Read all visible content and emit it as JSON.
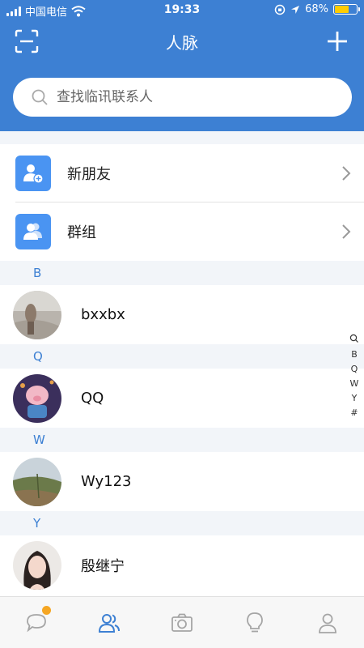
{
  "status": {
    "carrier": "中国电信",
    "time": "19:33",
    "battery": "68%",
    "battery_level": 0.68
  },
  "header": {
    "title": "人脉"
  },
  "search": {
    "placeholder": "查找临讯联系人"
  },
  "entries": [
    {
      "label": "新朋友",
      "icon": "add-user-icon"
    },
    {
      "label": "群组",
      "icon": "group-icon"
    }
  ],
  "sections": [
    {
      "letter": "B",
      "contacts": [
        {
          "name": "bxxbx"
        }
      ]
    },
    {
      "letter": "Q",
      "contacts": [
        {
          "name": "QQ"
        }
      ]
    },
    {
      "letter": "W",
      "contacts": [
        {
          "name": "Wy123"
        }
      ]
    },
    {
      "letter": "Y",
      "contacts": [
        {
          "name": "殷继宁"
        }
      ]
    }
  ],
  "index": [
    "B",
    "Q",
    "W",
    "Y",
    "#"
  ],
  "tabs": [
    {
      "icon": "chat-icon",
      "badge": true
    },
    {
      "icon": "contacts-icon",
      "active": true
    },
    {
      "icon": "camera-icon"
    },
    {
      "icon": "lightbulb-icon"
    },
    {
      "icon": "profile-icon"
    }
  ],
  "colors": {
    "accent": "#3d80d3",
    "badge": "#f5a623",
    "entry_icon": "#4a94f2"
  }
}
